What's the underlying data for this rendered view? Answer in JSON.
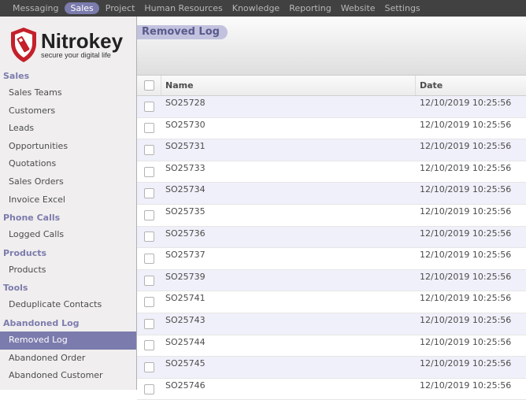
{
  "topnav": [
    "Messaging",
    "Sales",
    "Project",
    "Human Resources",
    "Knowledge",
    "Reporting",
    "Website",
    "Settings"
  ],
  "active_topnav": "Sales",
  "logo": {
    "name": "Nitrokey",
    "tagline": "secure your digital life"
  },
  "sidebar": [
    {
      "section": "Sales",
      "items": [
        "Sales Teams",
        "Customers",
        "Leads",
        "Opportunities",
        "Quotations",
        "Sales Orders",
        "Invoice Excel"
      ]
    },
    {
      "section": "Phone Calls",
      "items": [
        "Logged Calls"
      ]
    },
    {
      "section": "Products",
      "items": [
        "Products"
      ]
    },
    {
      "section": "Tools",
      "items": [
        "Deduplicate Contacts"
      ]
    },
    {
      "section": "Abandoned Log",
      "items": [
        "Removed Log",
        "Abandoned Order",
        "Abandoned Customer"
      ]
    }
  ],
  "active_sidebar": "Removed Log",
  "page": {
    "title": "Removed Log"
  },
  "table": {
    "columns": [
      "Name",
      "Date"
    ],
    "rows": [
      [
        "SO25728",
        "12/10/2019 10:25:56"
      ],
      [
        "SO25730",
        "12/10/2019 10:25:56"
      ],
      [
        "SO25731",
        "12/10/2019 10:25:56"
      ],
      [
        "SO25733",
        "12/10/2019 10:25:56"
      ],
      [
        "SO25734",
        "12/10/2019 10:25:56"
      ],
      [
        "SO25735",
        "12/10/2019 10:25:56"
      ],
      [
        "SO25736",
        "12/10/2019 10:25:56"
      ],
      [
        "SO25737",
        "12/10/2019 10:25:56"
      ],
      [
        "SO25739",
        "12/10/2019 10:25:56"
      ],
      [
        "SO25741",
        "12/10/2019 10:25:56"
      ],
      [
        "SO25743",
        "12/10/2019 10:25:56"
      ],
      [
        "SO25744",
        "12/10/2019 10:25:56"
      ],
      [
        "SO25745",
        "12/10/2019 10:25:56"
      ],
      [
        "SO25746",
        "12/10/2019 10:25:56"
      ]
    ]
  },
  "colors": {
    "topbar": "#414141",
    "accent": "#7c7bad",
    "logo_red": "#c4202b"
  }
}
